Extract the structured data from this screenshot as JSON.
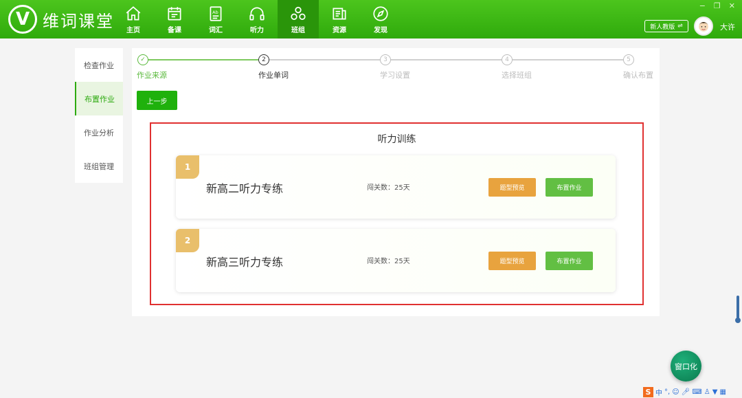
{
  "app": {
    "logo_letter": "V",
    "name": "维词课堂"
  },
  "nav": {
    "items": [
      {
        "label": "主页",
        "icon": "home-icon"
      },
      {
        "label": "备课",
        "icon": "calendar-icon"
      },
      {
        "label": "词汇",
        "icon": "vocab-book-icon"
      },
      {
        "label": "听力",
        "icon": "headphones-icon"
      },
      {
        "label": "班组",
        "icon": "group-icon"
      },
      {
        "label": "资源",
        "icon": "resources-icon"
      },
      {
        "label": "发现",
        "icon": "compass-icon"
      }
    ],
    "active": "班组"
  },
  "user": {
    "newbie_label": "新人教版",
    "name": "大许"
  },
  "sidebar": {
    "items": [
      {
        "label": "检查作业"
      },
      {
        "label": "布置作业"
      },
      {
        "label": "作业分析"
      },
      {
        "label": "班组管理"
      }
    ],
    "active": "布置作业"
  },
  "steps": [
    {
      "num": "✓",
      "label": "作业来源",
      "state": "done"
    },
    {
      "num": "2",
      "label": "作业单词",
      "state": "current"
    },
    {
      "num": "3",
      "label": "学习设置",
      "state": "pending"
    },
    {
      "num": "4",
      "label": "选择班组",
      "state": "pending"
    },
    {
      "num": "5",
      "label": "确认布置",
      "state": "pending"
    }
  ],
  "prev_button": "上一步",
  "section": {
    "title": "听力训练",
    "cards": [
      {
        "num": "1",
        "title": "新高二听力专练",
        "days": "闯关数：25天",
        "preview": "题型预览",
        "assign": "布置作业"
      },
      {
        "num": "2",
        "title": "新高三听力专练",
        "days": "闯关数：25天",
        "preview": "题型预览",
        "assign": "布置作业"
      }
    ]
  },
  "float_button": "窗口化",
  "tray": {
    "ime_logo": "S",
    "ime_mode": "中"
  },
  "colors": {
    "brand_green": "#2faa0c",
    "button_orange": "#e8a33e",
    "button_green": "#62bf43",
    "highlight_red": "#e03030"
  }
}
